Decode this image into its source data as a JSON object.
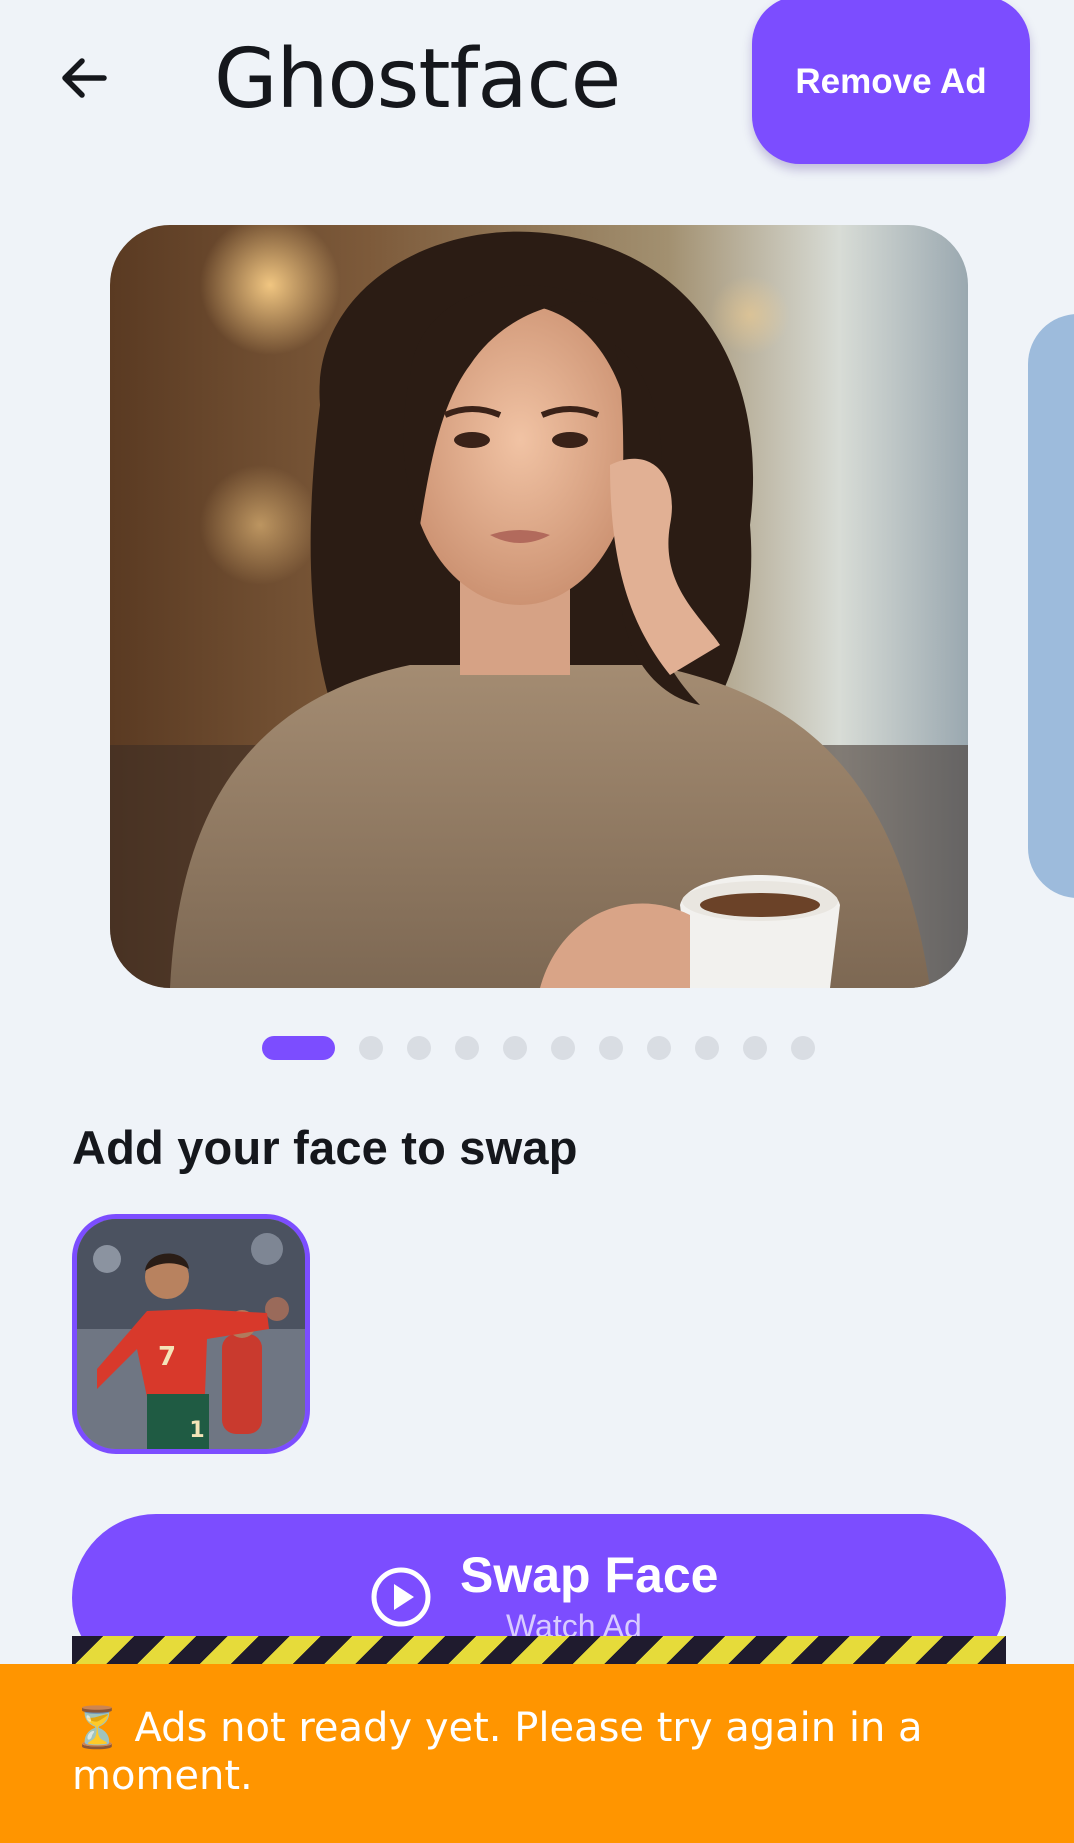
{
  "header": {
    "title": "Ghostface",
    "remove_ad_label": "Remove Ad",
    "back_icon": "arrow-left-icon"
  },
  "carousel": {
    "page_count": 11,
    "active_index": 0
  },
  "face_section": {
    "heading": "Add your face to swap"
  },
  "swap_button": {
    "label": "Swap Face",
    "sublabel": "Watch Ad",
    "icon": "play-circle-icon"
  },
  "toast": {
    "message": "⏳ Ads not ready yet. Please try again in a moment."
  },
  "colors": {
    "accent": "#7c4dff",
    "toast": "#ff9500",
    "background": "#eff3f8"
  }
}
